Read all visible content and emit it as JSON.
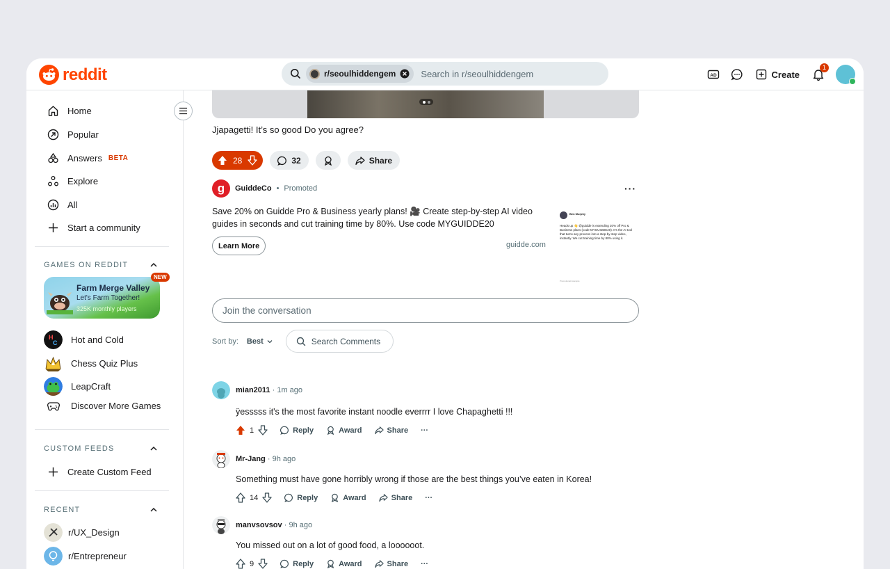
{
  "header": {
    "logo_text": "reddit",
    "search_chip": "r/seoulhiddengem",
    "search_placeholder": "Search in r/seoulhiddengem",
    "create_label": "Create",
    "notification_count": "1"
  },
  "sidebar": {
    "nav": [
      {
        "label": "Home",
        "icon": "home-icon"
      },
      {
        "label": "Popular",
        "icon": "popular-icon"
      },
      {
        "label": "Answers",
        "icon": "answers-icon",
        "badge": "BETA"
      },
      {
        "label": "Explore",
        "icon": "explore-icon"
      },
      {
        "label": "All",
        "icon": "all-icon"
      },
      {
        "label": "Start a community",
        "icon": "plus-icon"
      }
    ],
    "games_heading": "GAMES ON REDDIT",
    "featured_game": {
      "title": "Farm Merge Valley",
      "subtitle": "Let's Farm Together!",
      "players": "325K monthly players",
      "badge": "NEW"
    },
    "games": [
      {
        "label": "Hot and Cold"
      },
      {
        "label": "Chess Quiz Plus"
      },
      {
        "label": "LeapCraft"
      },
      {
        "label": "Discover More Games"
      }
    ],
    "custom_feeds_heading": "CUSTOM FEEDS",
    "create_custom_feed": "Create Custom Feed",
    "recent_heading": "RECENT",
    "recent": [
      {
        "label": "r/UX_Design"
      },
      {
        "label": "r/Entrepreneur"
      }
    ]
  },
  "post": {
    "caption": "Jjapagetti! It’s so good Do you agree?",
    "upvotes": "28",
    "comments": "32",
    "share_label": "Share"
  },
  "ad": {
    "advertiser": "GuiddeCo",
    "promoted": "Promoted",
    "logo_letter": "g",
    "text": "Save 20% on Guidde Pro & Business yearly plans! 🎥 Create step-by-step AI video guides in seconds and cut training time by 80%. Use code MYGUIDDE20",
    "cta": "Learn More",
    "domain": "guidde.com",
    "thumb_name": "Ben Murphy",
    "thumb_text": "Heads up 👋 @guidde is extending 20% off Pro & Business plans (code MYGUIDDE20). It's the AI tool that turns any process into a step-by-step video, instantly. We cut training time by 80% using it.",
    "thumb_footer": "Promotional Example"
  },
  "comment_box": {
    "placeholder": "Join the conversation",
    "sort_label": "Sort by:",
    "sort_value": "Best",
    "search_comments": "Search Comments"
  },
  "comments": [
    {
      "user": "mian2011",
      "time": "1m ago",
      "body": "ÿesssss it's the most favorite instant noodle everrrr I love Chapaghetti !!!",
      "votes": "1",
      "upvoted": true
    },
    {
      "user": "Mr-Jang",
      "time": "9h ago",
      "body": "Something must have gone horribly wrong if those are the best things you’ve eaten in Korea!",
      "votes": "14",
      "upvoted": false
    },
    {
      "user": "manvsovsov",
      "time": "9h ago",
      "body": "You missed out on a lot of good food, a loooooot.",
      "votes": "9",
      "upvoted": false
    }
  ],
  "comment_actions": {
    "reply": "Reply",
    "award": "Award",
    "share": "Share",
    "more": "···"
  },
  "colors": {
    "brand": "#ff4500",
    "upvote": "#d93900",
    "text": "#1a1a1b",
    "muted": "#576f76"
  }
}
